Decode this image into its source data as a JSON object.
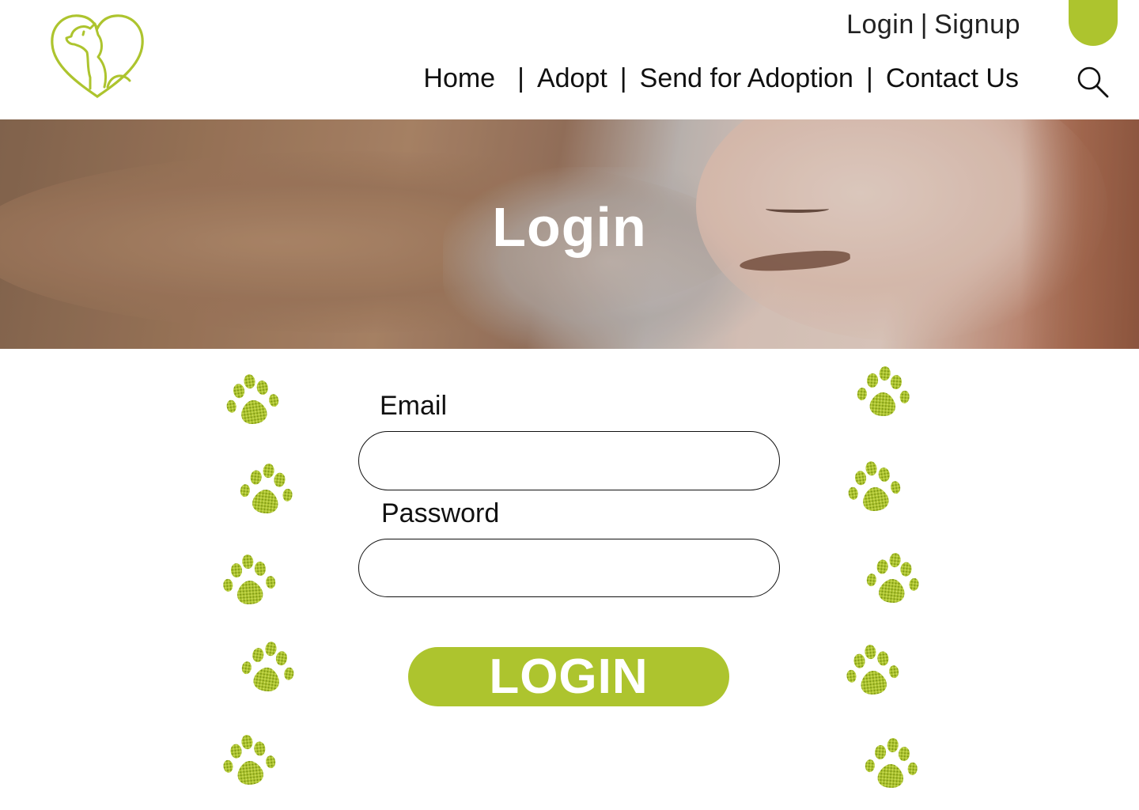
{
  "header": {
    "logo": {
      "name": "dog-heart-logo",
      "color": "#adc42e"
    },
    "auth": {
      "login": "Login",
      "separator": "|",
      "signup": "Signup"
    },
    "nav": {
      "items": [
        "Home",
        "Adopt",
        "Send for Adoption",
        "Contact Us"
      ],
      "separator": "|"
    },
    "search_icon": "search-icon"
  },
  "hero": {
    "title": "Login"
  },
  "form": {
    "email_label": "Email",
    "email_value": "",
    "password_label": "Password",
    "password_value": "",
    "submit_label": "LOGIN"
  },
  "decor": {
    "paw_icon": "paw-print-icon",
    "paw_count_left": 5,
    "paw_count_right": 5
  },
  "colors": {
    "accent": "#adc42e",
    "text": "#111111",
    "background": "#ffffff"
  }
}
